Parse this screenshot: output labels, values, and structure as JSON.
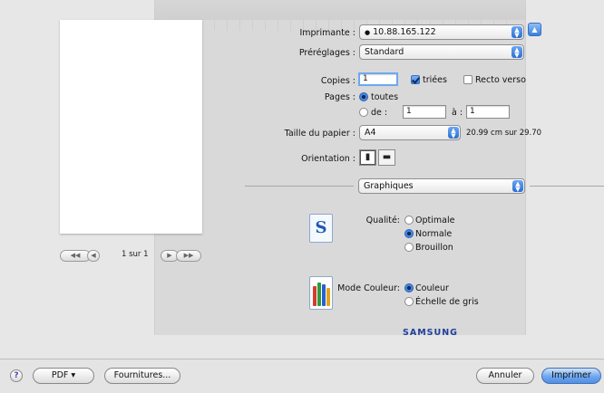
{
  "preview": {
    "page_indicator": "1 sur 1",
    "nav": {
      "first": "◀◀",
      "prev": "◀",
      "next": "▶",
      "last": "▶▶"
    }
  },
  "printer": {
    "label": "Imprimante :",
    "value": "10.88.165.122",
    "status_glyph": "●"
  },
  "presets": {
    "label": "Préréglages :",
    "value": "Standard"
  },
  "copies": {
    "label": "Copies :",
    "value": "1",
    "collate_label": "triées",
    "collate_checked": true,
    "duplex_label": "Recto verso",
    "duplex_checked": false
  },
  "pages": {
    "label": "Pages :",
    "all_label": "toutes",
    "all_selected": true,
    "from_label": "de :",
    "from_value": "1",
    "to_label": "à :",
    "to_value": "1"
  },
  "paper": {
    "label": "Taille du papier :",
    "value": "A4",
    "dimensions": "20.99 cm sur 29.70"
  },
  "orientation": {
    "label": "Orientation :",
    "portrait_glyph": "▮",
    "landscape_glyph": "▬"
  },
  "panel": {
    "value": "Graphiques"
  },
  "quality": {
    "label": "Qualité:",
    "icon_glyph": "S",
    "options": [
      {
        "label": "Optimale",
        "selected": false
      },
      {
        "label": "Normale",
        "selected": true
      },
      {
        "label": "Brouillon",
        "selected": false
      }
    ]
  },
  "color_mode": {
    "label": "Mode Couleur:",
    "options": [
      {
        "label": "Couleur",
        "selected": true
      },
      {
        "label": "Échelle de gris",
        "selected": false
      }
    ],
    "bar_colors": [
      "#d83a2e",
      "#2f9a3f",
      "#2a5fd0",
      "#e0a51e"
    ]
  },
  "brand": {
    "name": "SAMSUNG",
    "color": "#1f3f9c"
  },
  "footer": {
    "help_glyph": "?",
    "pdf_label": "PDF ▾",
    "supplies_label": "Fournitures...",
    "cancel_label": "Annuler",
    "print_label": "Imprimer"
  },
  "colors": {
    "accent": "#3b7fe0",
    "dialog_bg": "#e7e7e7"
  }
}
